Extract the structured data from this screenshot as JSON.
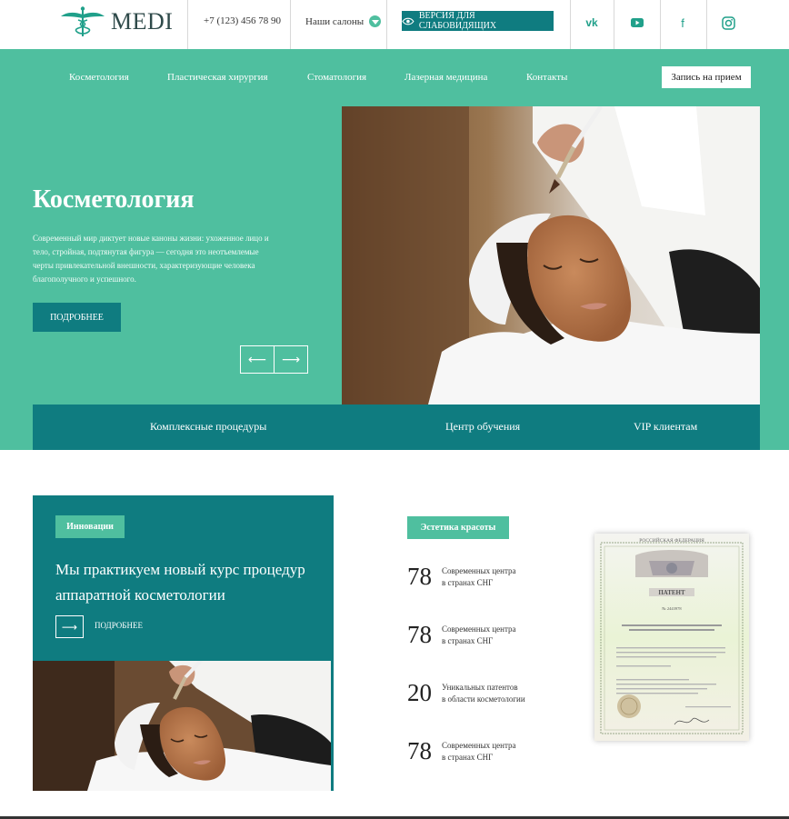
{
  "header": {
    "logo_text": "MEDI",
    "phone": "+7 (123) 456 78 90",
    "salons_label": "Наши салоны",
    "vision_button": "ВЕРСИЯ ДЛЯ СЛАБОВИДЯЩИХ",
    "social": [
      {
        "icon": "vk-icon",
        "glyph": "vk"
      },
      {
        "icon": "youtube-icon",
        "glyph": "▶"
      },
      {
        "icon": "facebook-icon",
        "glyph": "f"
      },
      {
        "icon": "instagram-icon",
        "glyph": "◎"
      }
    ]
  },
  "nav": {
    "items": [
      "Косметология",
      "Пластическая хирургия",
      "Стоматология",
      "Лазерная медицина",
      "Контакты"
    ],
    "book_button": "Запись на прием"
  },
  "hero": {
    "title": "Косметология",
    "description": "Современный мир диктует новые каноны жизни: ухоженное лицо и тело, стройная, подтянутая фигура — сегодня это неотъемлемые черты привлекательной внешности, характеризующие человека благополучного и успешного.",
    "more_button": "ПОДРОБНЕЕ",
    "prev_arrow": "⟵",
    "next_arrow": "⟶"
  },
  "categories": [
    "Комплексные процедуры",
    "Центр обучения",
    "VIP клиентам"
  ],
  "innovation_card": {
    "tag": "Инновации",
    "title": "Мы практикуем новый курс процедур аппаратной косметологии",
    "arrow": "⟶",
    "more": "ПОДРОБНЕЕ"
  },
  "stats": {
    "tag": "Эстетика красоты",
    "items": [
      {
        "number": "78",
        "line1": "Современных центра",
        "line2": "в странах СНГ"
      },
      {
        "number": "78",
        "line1": "Современных центра",
        "line2": "в странах СНГ"
      },
      {
        "number": "20",
        "line1": "Уникальных патентов",
        "line2": "в области косметологии"
      },
      {
        "number": "78",
        "line1": "Современных центра",
        "line2": "в странах СНГ"
      }
    ]
  },
  "patent": {
    "country": "РОССИЙСКАЯ ФЕДЕРАЦИЯ",
    "title": "ПАТЕНТ",
    "number": "№ 2443978"
  },
  "colors": {
    "accent": "#4fbf9f",
    "dark_teal": "#0f7c80"
  }
}
